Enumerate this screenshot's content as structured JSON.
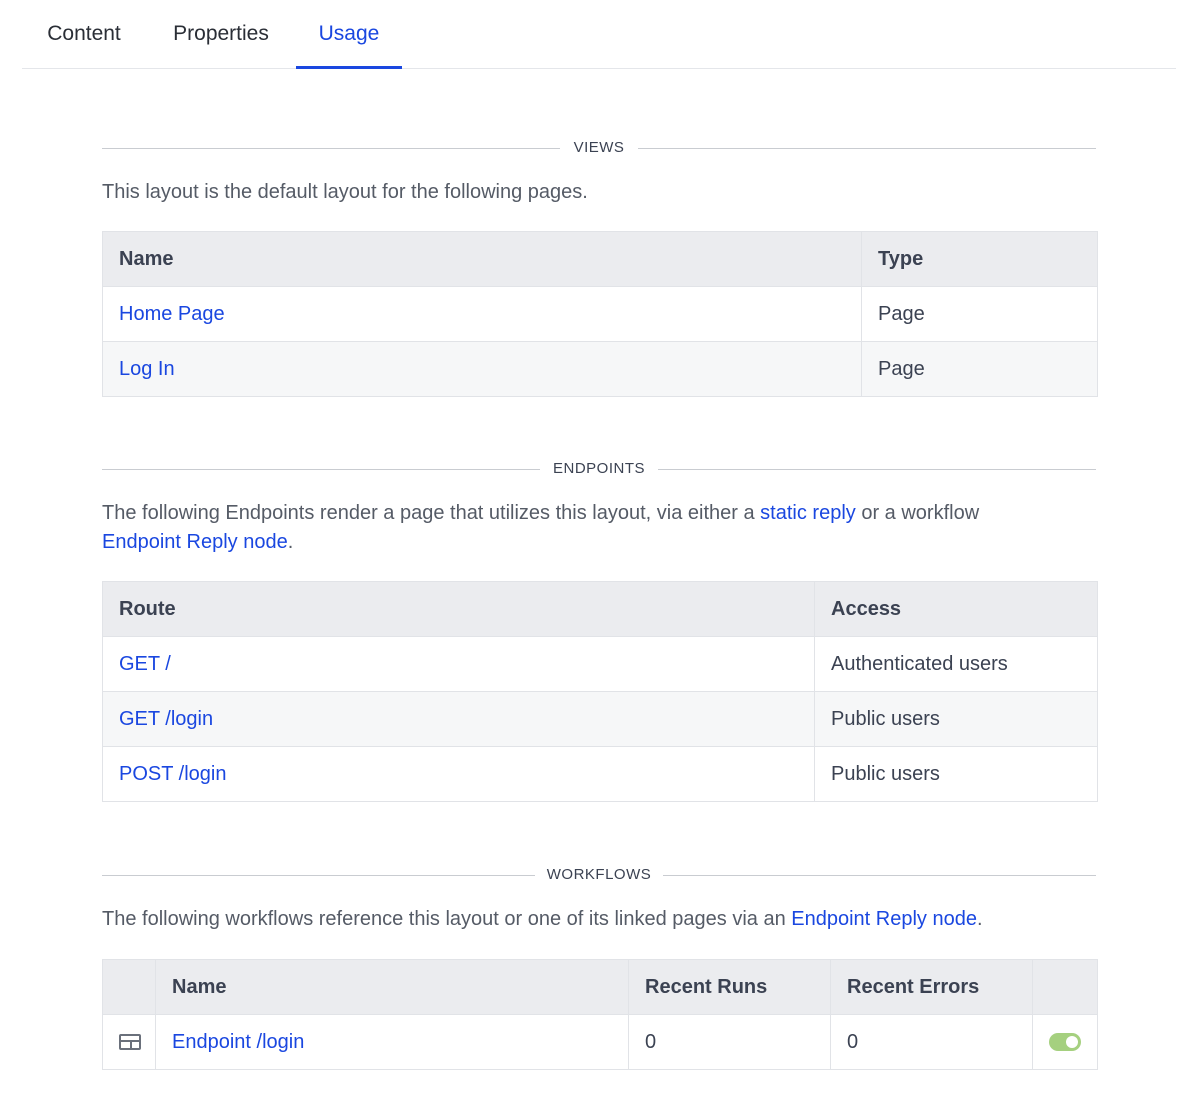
{
  "tabs": [
    "Content",
    "Properties",
    "Usage"
  ],
  "views": {
    "heading": "VIEWS",
    "description": "This layout is the default layout for the following pages.",
    "columns": [
      "Name",
      "Type"
    ],
    "rows": [
      {
        "name": "Home Page",
        "type": "Page"
      },
      {
        "name": "Log In",
        "type": "Page"
      }
    ]
  },
  "endpoints": {
    "heading": "ENDPOINTS",
    "desc_before": "The following Endpoints render a page that utilizes this layout, via either a ",
    "desc_link1": "static reply",
    "desc_middle": " or a workflow",
    "desc_link2": "Endpoint Reply node",
    "desc_after": ".",
    "columns": [
      "Route",
      "Access"
    ],
    "rows": [
      {
        "route": "GET /",
        "access": "Authenticated users"
      },
      {
        "route": "GET /login",
        "access": "Public users"
      },
      {
        "route": "POST /login",
        "access": "Public users"
      }
    ]
  },
  "workflows": {
    "heading": "WORKFLOWS",
    "desc_before": "The following workflows reference this layout or one of its linked pages via an ",
    "desc_link": "Endpoint Reply node",
    "desc_after": ".",
    "columns": [
      "Name",
      "Recent Runs",
      "Recent Errors"
    ],
    "rows": [
      {
        "icon": "workflow-icon",
        "name": "Endpoint /login",
        "runs": "0",
        "errors": "0",
        "enabled": true
      }
    ]
  },
  "colors": {
    "accent": "#1a47e0",
    "toggle_on": "#a5d07f"
  }
}
